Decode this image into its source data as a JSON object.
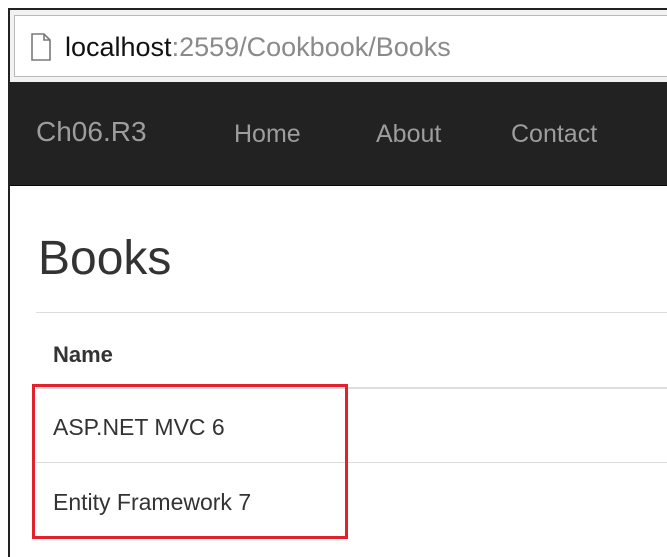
{
  "browser": {
    "url_host": "localhost",
    "url_path": ":2559/Cookbook/Books",
    "page_icon": "page-icon"
  },
  "navbar": {
    "brand": "Ch06.R3",
    "links": [
      {
        "label": "Home"
      },
      {
        "label": "About"
      },
      {
        "label": "Contact"
      }
    ]
  },
  "main": {
    "title": "Books",
    "table": {
      "columns": [
        "Name"
      ],
      "rows": [
        {
          "name": "ASP.NET MVC 6"
        },
        {
          "name": "Entity Framework 7"
        }
      ]
    }
  },
  "colors": {
    "navbar_bg": "#222222",
    "nav_text": "#9d9d9d",
    "highlight": "#e3202b"
  }
}
